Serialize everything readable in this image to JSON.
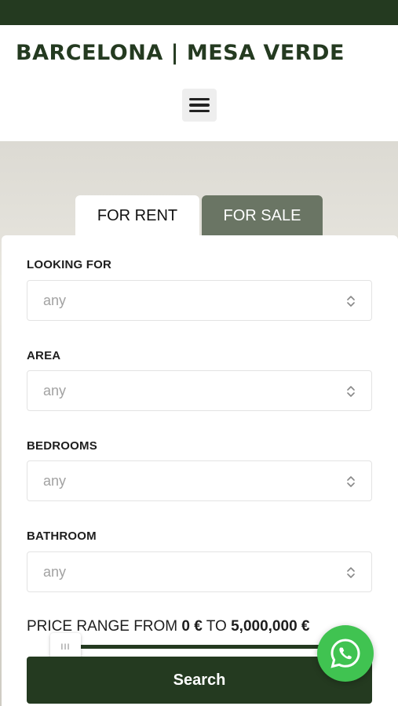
{
  "header": {
    "logo_text": "BARCELONA | MESA VERDE",
    "menu_icon": "hamburger-menu-icon"
  },
  "tabs": [
    {
      "label": "FOR RENT",
      "active": true
    },
    {
      "label": "FOR SALE",
      "active": false
    }
  ],
  "form": {
    "fields": [
      {
        "label": "LOOKING FOR",
        "value": "any"
      },
      {
        "label": "AREA",
        "value": "any"
      },
      {
        "label": "BEDROOMS",
        "value": "any"
      },
      {
        "label": "BATHROOM",
        "value": "any"
      }
    ],
    "price_range": {
      "label": "PRICE RANGE",
      "from_label": "FROM",
      "from_value": "0 €",
      "to_label": "TO",
      "to_value": "5,000,000 €",
      "handle_glyph": "III"
    },
    "search_label": "Search"
  },
  "colors": {
    "brand_dark_green": "#243a20",
    "tab_inactive": "#6a7564",
    "whatsapp_green": "#40c351"
  },
  "floating": {
    "whatsapp_icon": "whatsapp-icon"
  }
}
